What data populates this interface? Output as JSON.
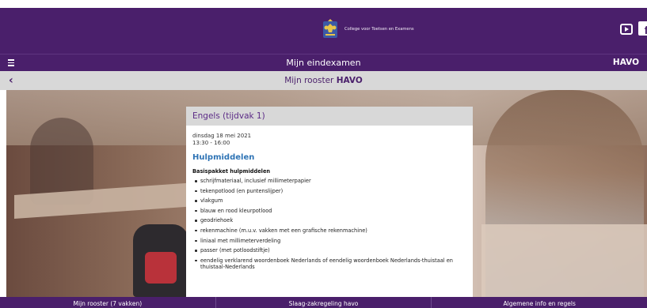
{
  "header": {
    "org_name": "College voor Toetsen en Examens",
    "logo_icon": "coat-of-arms-icon",
    "social": [
      "youtube-icon",
      "facebook-icon"
    ]
  },
  "nav": {
    "menu_icon": "hamburger-menu-icon",
    "title": "Mijn eindexamen",
    "level": "HAVO"
  },
  "subheader": {
    "back_icon": "chevron-left-icon",
    "title_prefix": "Mijn rooster ",
    "title_bold": "HAVO"
  },
  "card": {
    "title": "Engels (tijdvak 1)",
    "date": "dinsdag 18 mei 2021",
    "time": "13:30 - 16:00",
    "section": "Hulpmiddelen",
    "list_title": "Basispakket hulpmiddelen",
    "items": [
      "schrijfmateriaal, inclusief millimeterpapier",
      "tekenpotlood (en puntenslijper)",
      "vlakgum",
      "blauw en rood kleurpotlood",
      "geodriehoek",
      "rekenmachine (m.u.v. vakken met een grafische rekenmachine)",
      "liniaal met millimeterverdeling",
      "passer (met potloodstiftje)",
      "eendelig verklarend woordenboek Nederlands of eendelig woordenboek Nederlands-thuistaal en thuistaal-Nederlands"
    ]
  },
  "bottom_nav": [
    "Mijn rooster (7 vakken)",
    "Slaag-zakregeling havo",
    "Algemene info en regels"
  ],
  "colors": {
    "brand_purple": "#4a1f6b",
    "heading_blue": "#2f74b5",
    "bar_grey": "#d8d8d8"
  }
}
